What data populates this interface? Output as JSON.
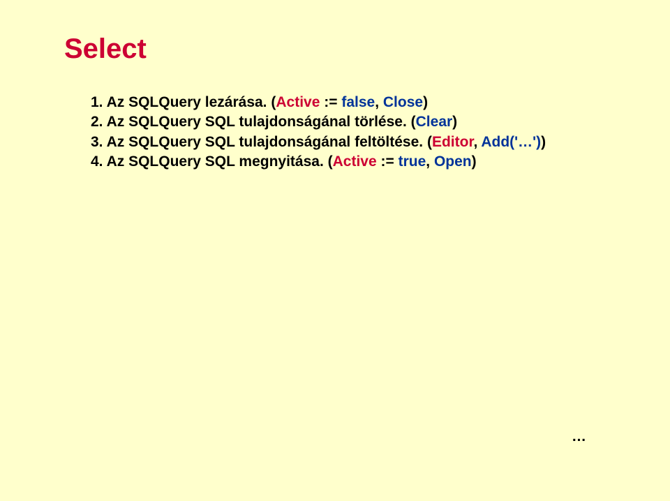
{
  "title": "Select",
  "items": [
    {
      "num": "1.",
      "text_before": "Az SQLQuery lezárása. ",
      "paren_open": "(",
      "red1": "Active",
      "black1": " := ",
      "blue1": "false",
      "black2": ", ",
      "blue2": "Close",
      "paren_close": ")"
    },
    {
      "num": "2.",
      "text_before": "Az SQLQuery SQL tulajdonságánal törlése. ",
      "paren_open": "(",
      "blue1": "Clear",
      "paren_close": ")"
    },
    {
      "num": "3.",
      "text_before": "Az SQLQuery SQL tulajdonságánal feltöltése. ",
      "paren_open": "(",
      "red1": "Editor",
      "black1": ", ",
      "blue1": "Add('…')",
      "paren_close": ")"
    },
    {
      "num": "4.",
      "text_before": "Az SQLQuery SQL megnyitása. ",
      "paren_open": "(",
      "red1": "Active",
      "black1": " := ",
      "blue1": "true",
      "black2": ", ",
      "blue2": "Open",
      "paren_close": ")"
    }
  ],
  "ellipsis": "…"
}
